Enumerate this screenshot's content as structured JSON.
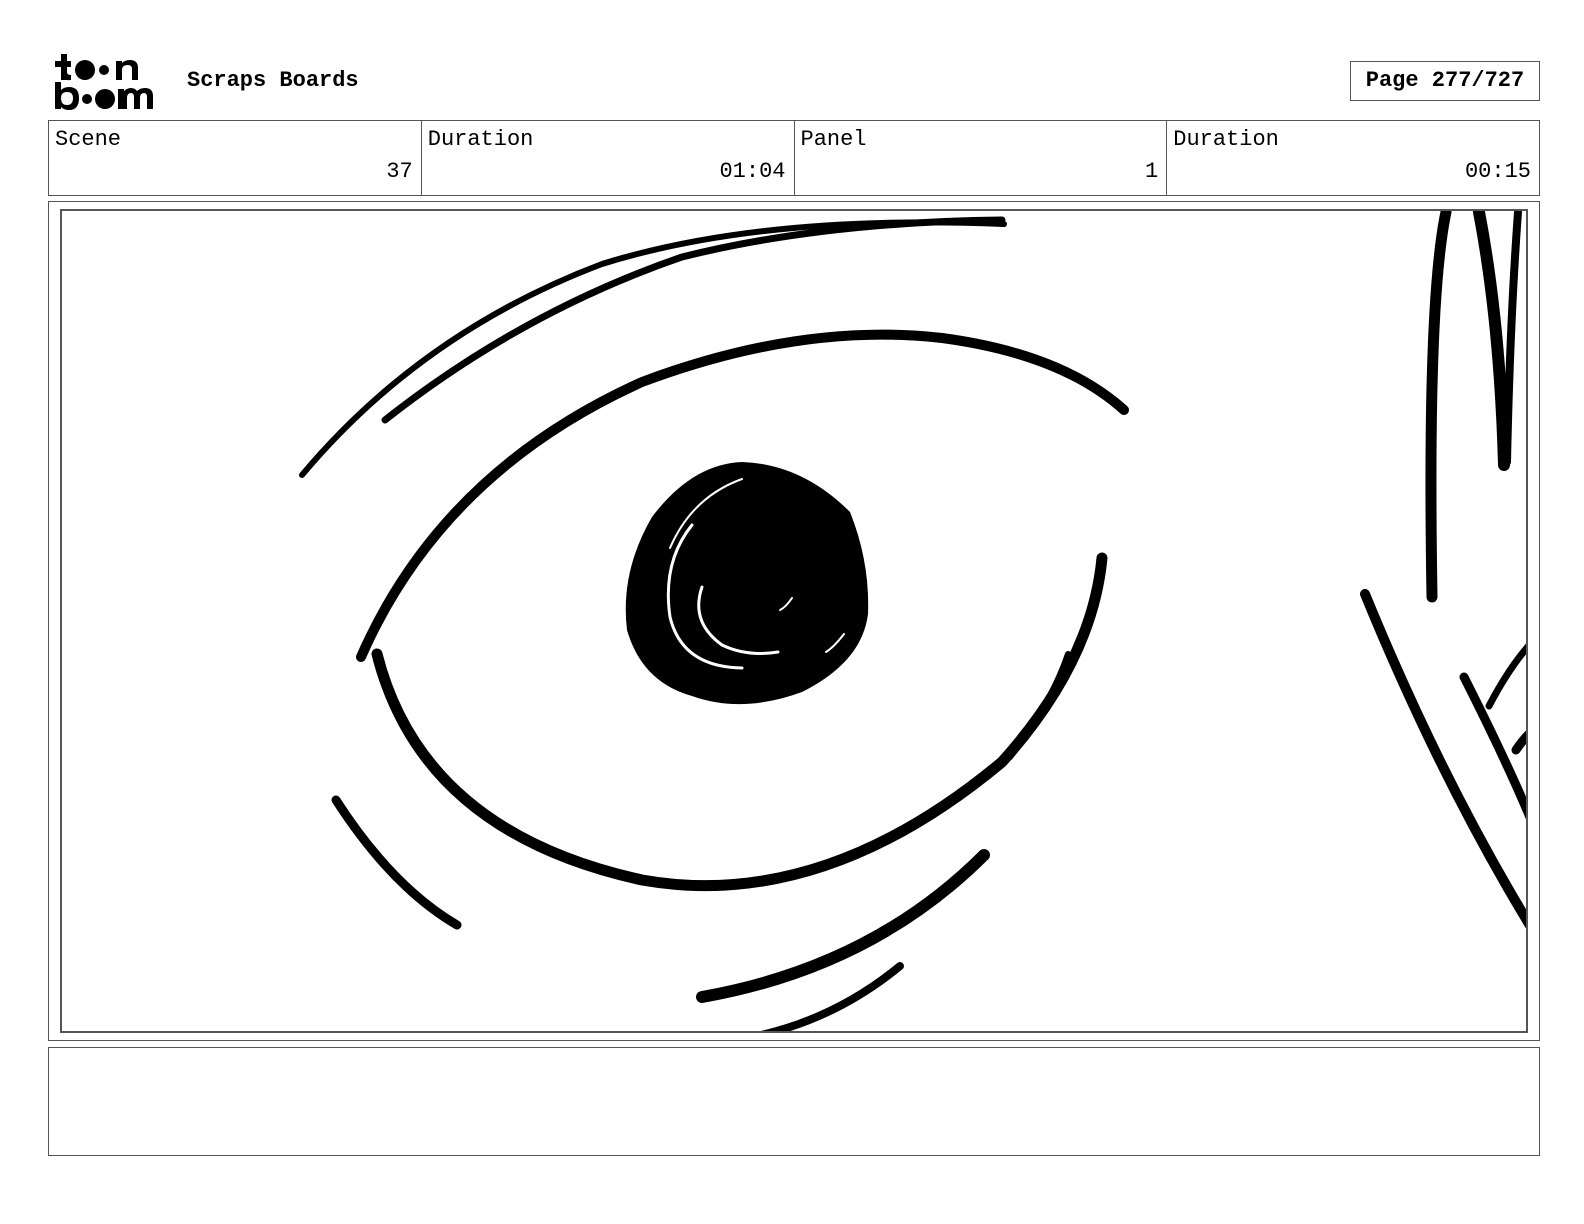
{
  "header": {
    "logo_text_top": "toon",
    "logo_text_bottom": "boom",
    "title": "Scraps Boards",
    "page_label": "Page 277/727"
  },
  "info": {
    "scene_label": "Scene",
    "scene_value": "37",
    "scene_duration_label": "Duration",
    "scene_duration_value": "01:04",
    "panel_label": "Panel",
    "panel_value": "1",
    "panel_duration_label": "Duration",
    "panel_duration_value": "00:15"
  },
  "panel": {
    "drawing": "eye-sketch"
  },
  "notes": {
    "text": ""
  }
}
